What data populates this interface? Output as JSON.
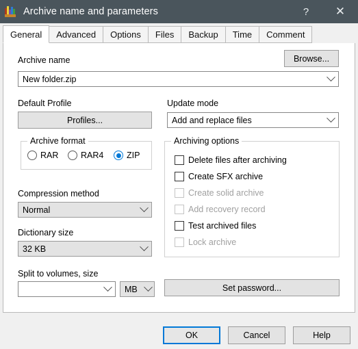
{
  "window": {
    "title": "Archive name and parameters",
    "icon": "winrar-books-icon",
    "help_glyph": "?",
    "close_glyph": "✕"
  },
  "tabs": [
    {
      "label": "General",
      "active": true
    },
    {
      "label": "Advanced",
      "active": false
    },
    {
      "label": "Options",
      "active": false
    },
    {
      "label": "Files",
      "active": false
    },
    {
      "label": "Backup",
      "active": false
    },
    {
      "label": "Time",
      "active": false
    },
    {
      "label": "Comment",
      "active": false
    }
  ],
  "general": {
    "archive_name_label": "Archive name",
    "archive_name_value": "New folder.zip",
    "browse_button": "Browse...",
    "default_profile_label": "Default Profile",
    "profiles_button": "Profiles...",
    "update_mode_label": "Update mode",
    "update_mode_value": "Add and replace files",
    "archive_format": {
      "title": "Archive format",
      "options": [
        {
          "label": "RAR",
          "selected": false
        },
        {
          "label": "RAR4",
          "selected": false
        },
        {
          "label": "ZIP",
          "selected": true
        }
      ]
    },
    "compression_method_label": "Compression method",
    "compression_method_value": "Normal",
    "dictionary_size_label": "Dictionary size",
    "dictionary_size_value": "32 KB",
    "split_label": "Split to volumes, size",
    "split_value": "",
    "split_unit_value": "MB",
    "archiving_options": {
      "title": "Archiving options",
      "items": [
        {
          "label": "Delete files after archiving",
          "checked": false,
          "enabled": true
        },
        {
          "label": "Create SFX archive",
          "checked": false,
          "enabled": true
        },
        {
          "label": "Create solid archive",
          "checked": false,
          "enabled": false
        },
        {
          "label": "Add recovery record",
          "checked": false,
          "enabled": false
        },
        {
          "label": "Test archived files",
          "checked": false,
          "enabled": true
        },
        {
          "label": "Lock archive",
          "checked": false,
          "enabled": false
        }
      ]
    },
    "set_password_button": "Set password..."
  },
  "footer": {
    "ok_button": "OK",
    "cancel_button": "Cancel",
    "help_button": "Help"
  },
  "colors": {
    "titlebar": "#4a555c",
    "accent": "#0078d7",
    "control_face": "#e3e3e3",
    "dialog_face": "#f0f0f0"
  }
}
